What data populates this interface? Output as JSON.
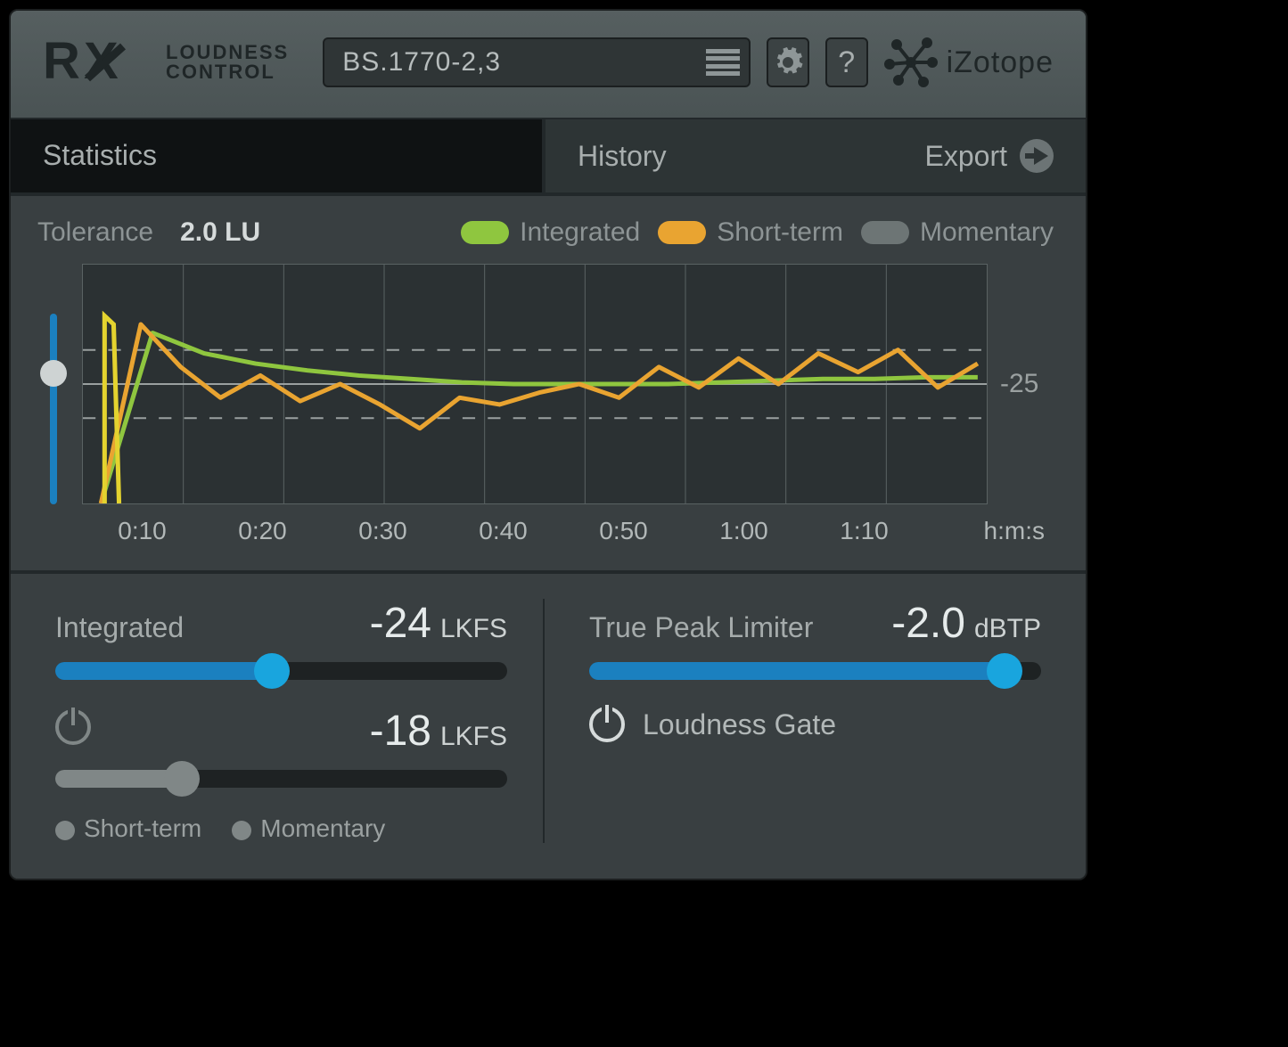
{
  "header": {
    "product_line1": "LOUDNESS",
    "product_line2": "CONTROL",
    "preset": "BS.1770-2,3",
    "help_label": "?",
    "brand": "iZotope"
  },
  "tabs": {
    "statistics": "Statistics",
    "history": "History",
    "export": "Export"
  },
  "legend": {
    "tolerance_label": "Tolerance",
    "tolerance_value": "2.0 LU",
    "integrated": "Integrated",
    "short_term": "Short-term",
    "momentary": "Momentary"
  },
  "chart_data": {
    "type": "line",
    "xlabel": "h:m:s",
    "x_ticks": [
      "0:10",
      "0:20",
      "0:30",
      "0:40",
      "0:50",
      "1:00",
      "1:10"
    ],
    "y_tick_label": "-25",
    "y_range": [
      -32,
      -18
    ],
    "tolerance_band": [
      -27,
      -23
    ],
    "target_line": -25,
    "series": [
      {
        "name": "Integrated",
        "color": "#8fc63f",
        "values": [
          -32,
          -22,
          -23.2,
          -23.8,
          -24.2,
          -24.5,
          -24.7,
          -24.9,
          -25.0,
          -25.0,
          -25.0,
          -25.0,
          -24.9,
          -24.8,
          -24.7,
          -24.7,
          -24.6,
          -24.6
        ]
      },
      {
        "name": "Short-term",
        "color": "#e9a431",
        "values": [
          -32,
          -21.5,
          -24.0,
          -25.8,
          -24.5,
          -26.0,
          -25.0,
          -26.2,
          -27.6,
          -25.8,
          -26.2,
          -25.5,
          -25.0,
          -25.8,
          -24.0,
          -25.2,
          -23.5,
          -25.0,
          -23.2,
          -24.3,
          -23.0,
          -25.2,
          -23.8
        ]
      }
    ]
  },
  "controls": {
    "integrated": {
      "label": "Integrated",
      "value": "-24",
      "unit": "LKFS",
      "slider_pct": 48
    },
    "secondary": {
      "value": "-18",
      "unit": "LKFS",
      "slider_pct": 28,
      "power_on": false
    },
    "radios": {
      "short_term": "Short-term",
      "momentary": "Momentary"
    },
    "tpl": {
      "label": "True Peak Limiter",
      "value": "-2.0",
      "unit": "dBTP",
      "slider_pct": 92
    },
    "gate": {
      "label": "Loudness Gate",
      "power_on": true
    }
  },
  "colors": {
    "accent": "#19a5de",
    "integrated": "#8fc63f",
    "short_term": "#e9a431",
    "momentary": "#6d7575"
  }
}
